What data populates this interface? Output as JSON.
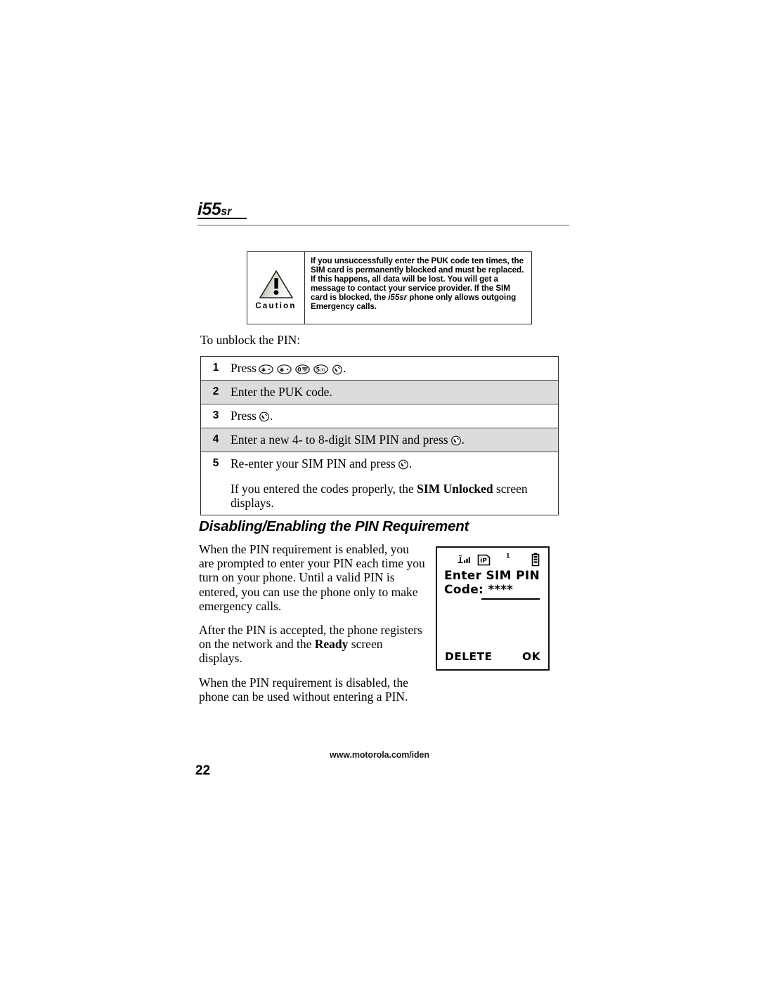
{
  "header": {
    "product_logo_main": "i55",
    "product_logo_suffix": "sr"
  },
  "caution": {
    "label": "Caution",
    "icon": "warning-triangle-icon",
    "text_part1": "If you unsuccessfully enter the PUK code ten times, the SIM card is permanently blocked and must be replaced. If this happens, all data will be lost. You will get a message to contact your service provider. If the SIM card is blocked, the ",
    "text_italic": "i55sr",
    "text_part2": " phone only allows outgoing Emergency calls."
  },
  "intro": {
    "text": "To unblock the PIN:"
  },
  "steps": {
    "rows": [
      {
        "number": "1",
        "text_before": "Press",
        "keys": [
          "star-key",
          "star-key",
          "zero-key",
          "five-key",
          "send-key"
        ],
        "text_after": "."
      },
      {
        "number": "2",
        "text_before": "Enter the PUK code.",
        "keys": [],
        "text_after": ""
      },
      {
        "number": "3",
        "text_before": "Press",
        "keys": [
          "send-key"
        ],
        "text_after": "."
      },
      {
        "number": "4",
        "text_before": "Enter a new 4- to 8-digit SIM PIN and press",
        "keys": [
          "send-key"
        ],
        "text_after": "."
      },
      {
        "number": "5",
        "text_before": "Re-enter your SIM PIN and press",
        "keys": [
          "send-key"
        ],
        "text_after": "."
      }
    ],
    "note_part1": "If you entered the codes properly, the ",
    "note_bold": "SIM Unlocked",
    "note_part2": " screen displays."
  },
  "section": {
    "heading": "Disabling/Enabling the PIN Requirement",
    "paragraph1": "When the PIN requirement is enabled, you are prompted to enter your PIN each time you turn on your phone. Until a valid PIN is entered, you can use the phone only to make emergency calls.",
    "paragraph2_part1": "After the PIN is accepted, the phone registers on the network and the ",
    "paragraph2_bold": "Ready",
    "paragraph2_part2": " screen displays.",
    "paragraph3": "When the PIN requirement is disabled, the phone can be used without entering a PIN."
  },
  "phone_display": {
    "status_indicator_number": "1",
    "status_icons": [
      "signal-strength-icon",
      "ip-badge-icon",
      "battery-icon"
    ],
    "line1": "Enter SIM PIN",
    "line2_label": "Code:",
    "line2_value": "****",
    "softkey_left": "DELETE",
    "softkey_right": "OK"
  },
  "footer": {
    "url": "www.motorola.com/iden",
    "page_number": "22"
  }
}
